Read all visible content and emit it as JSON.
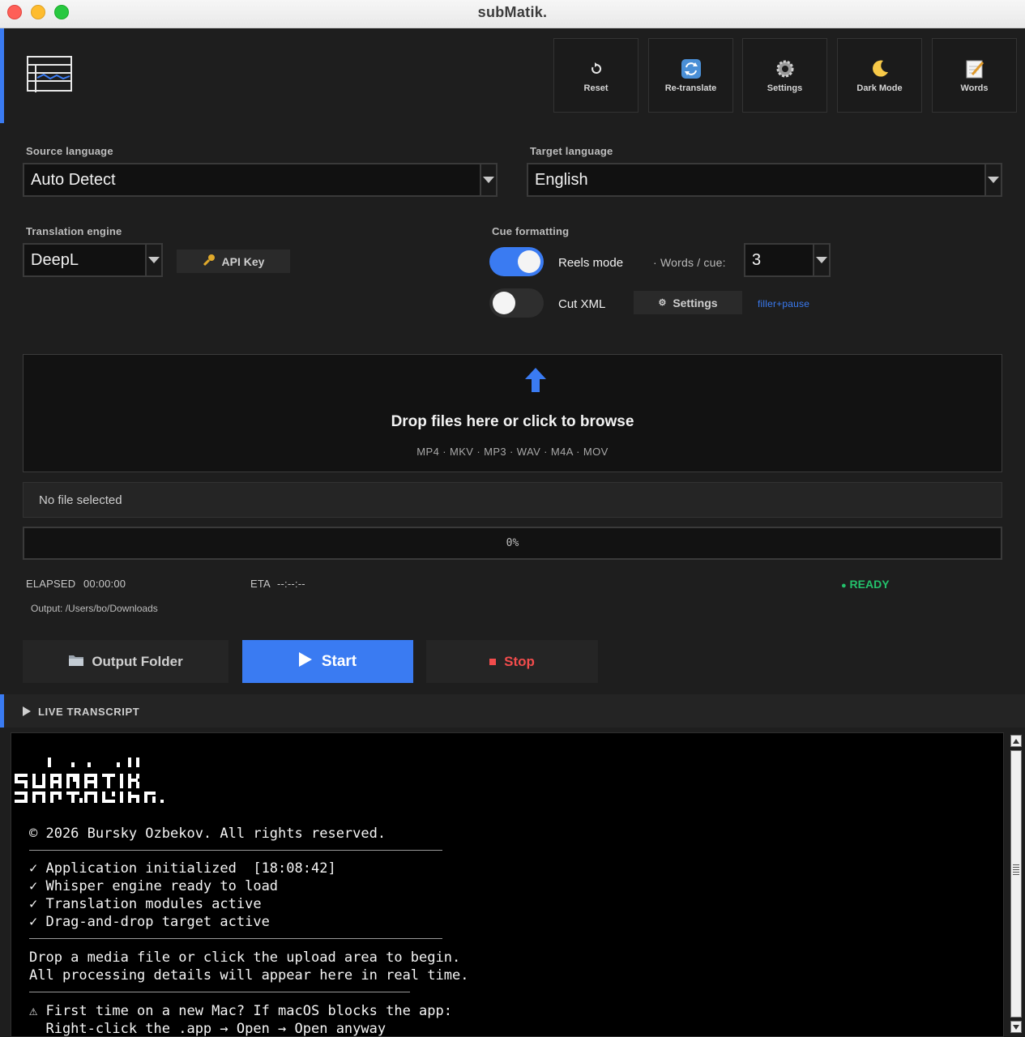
{
  "window": {
    "title": "subMatik."
  },
  "toolbar": {
    "items": [
      {
        "label": "Reset",
        "icon": "reset-icon"
      },
      {
        "label": "Re-translate",
        "icon": "retranslate-icon"
      },
      {
        "label": "Settings",
        "icon": "gear-icon"
      },
      {
        "label": "Dark Mode",
        "icon": "moon-icon"
      },
      {
        "label": "Words",
        "icon": "notepad-icon"
      }
    ]
  },
  "source_language": {
    "label": "Source language",
    "value": "Auto Detect"
  },
  "target_language": {
    "label": "Target language",
    "value": "English"
  },
  "translation_engine": {
    "label": "Translation engine",
    "value": "DeepL",
    "api_key_label": "API Key"
  },
  "cue_formatting": {
    "label": "Cue formatting",
    "reels_mode": {
      "label": "Reels mode",
      "on": true
    },
    "words_per_cue": {
      "label": "· Words / cue:",
      "value": "3"
    },
    "cut_xml": {
      "label": "Cut XML",
      "on": false
    },
    "settings_label": "Settings",
    "preset_link": "filler+pause"
  },
  "dropzone": {
    "title": "Drop files here or click to browse",
    "formats": "MP4 · MKV · MP3 · WAV · M4A · MOV"
  },
  "file": {
    "status": "No file selected"
  },
  "progress": {
    "percent": 0,
    "label": "0%"
  },
  "stats": {
    "elapsed_label": "ELAPSED",
    "elapsed_value": "00:00:00",
    "eta_label": "ETA",
    "eta_value": "--:--:--",
    "status": "READY"
  },
  "output": {
    "path": "Output: /Users/bo/Downloads"
  },
  "actions": {
    "output_folder": "Output Folder",
    "start": "Start",
    "stop": "Stop"
  },
  "transcript": {
    "header": "LIVE TRANSCRIPT",
    "lines": [
      "© 2026 Bursky Ozbekov. All rights reserved.",
      "✓ Application initialized  [18:08:42]",
      "✓ Whisper engine ready to load",
      "✓ Translation modules active",
      "✓ Drag-and-drop target active",
      "Drop a media file or click the upload area to begin.",
      "All processing details will appear here in real time.",
      "⚠ First time on a new Mac? If macOS blocks the app:",
      "  Right-click the .app → Open → Open anyway"
    ]
  },
  "colors": {
    "accent": "#3a7bf2",
    "ready": "#23c06b",
    "stop": "#f24c4c"
  }
}
